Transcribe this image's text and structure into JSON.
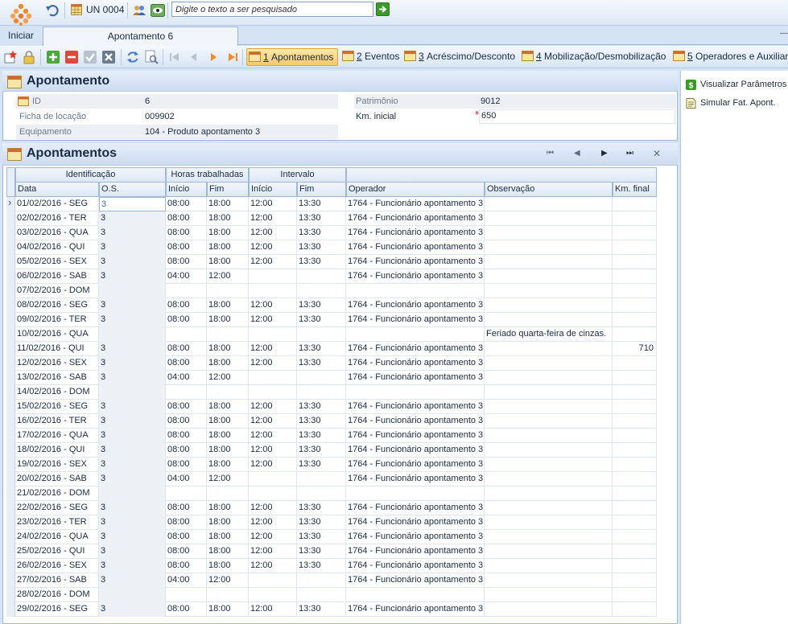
{
  "topbar": {
    "start_label": "Iniciar",
    "un_label": "UN 0004",
    "search_placeholder": "Digite o texto a ser pesquisado"
  },
  "tab": {
    "label": "Apontamento 6"
  },
  "toolbar": {
    "nav_tabs": [
      {
        "key": "1",
        "label": "Apontamentos"
      },
      {
        "key": "2",
        "label": "Eventos"
      },
      {
        "key": "3",
        "label": "Acréscimo/Desconto"
      },
      {
        "key": "4",
        "label": "Mobilização/Desmobilização"
      },
      {
        "key": "5",
        "label": "Operadores e Auxiliares"
      }
    ]
  },
  "side": {
    "links": [
      "Visualizar Parâmetros",
      "Simular Fat. Apont."
    ]
  },
  "apontamento": {
    "title": "Apontamento",
    "id_label": "ID",
    "id_value": "6",
    "ficha_label": "Ficha de locação",
    "ficha_value": "009902",
    "equip_label": "Equipamento",
    "equip_value": "104 - Produto apontamento 3",
    "patrimonio_label": "Patrimônio",
    "patrimonio_value": "9012",
    "km_label": "Km. inicial",
    "km_required": "*",
    "km_value": "650"
  },
  "grid": {
    "title": "Apontamentos",
    "bands": [
      "Identificação",
      "Horas trabalhadas",
      "Intervalo",
      ""
    ],
    "columns": [
      "Data",
      "O.S.",
      "Início",
      "Fim",
      "Início",
      "Fim",
      "Operador",
      "Observação",
      "Km. final"
    ],
    "rows": [
      [
        "01/02/2016 - SEG",
        "3",
        "08:00",
        "18:00",
        "12:00",
        "13:30",
        "1764 - Funcionário apontamento 3",
        "",
        ""
      ],
      [
        "02/02/2016 - TER",
        "3",
        "08:00",
        "18:00",
        "12:00",
        "13:30",
        "1764 - Funcionário apontamento 3",
        "",
        ""
      ],
      [
        "03/02/2016 - QUA",
        "3",
        "08:00",
        "18:00",
        "12:00",
        "13:30",
        "1764 - Funcionário apontamento 3",
        "",
        ""
      ],
      [
        "04/02/2016 - QUI",
        "3",
        "08:00",
        "18:00",
        "12:00",
        "13:30",
        "1764 - Funcionário apontamento 3",
        "",
        ""
      ],
      [
        "05/02/2016 - SEX",
        "3",
        "08:00",
        "18:00",
        "12:00",
        "13:30",
        "1764 - Funcionário apontamento 3",
        "",
        ""
      ],
      [
        "06/02/2016 - SAB",
        "3",
        "04:00",
        "12:00",
        "",
        "",
        "1764 - Funcionário apontamento 3",
        "",
        ""
      ],
      [
        "07/02/2016 - DOM",
        "",
        "",
        "",
        "",
        "",
        "",
        "",
        ""
      ],
      [
        "08/02/2016 - SEG",
        "3",
        "08:00",
        "18:00",
        "12:00",
        "13:30",
        "1764 - Funcionário apontamento 3",
        "",
        ""
      ],
      [
        "09/02/2016 - TER",
        "3",
        "08:00",
        "18:00",
        "12:00",
        "13:30",
        "1764 - Funcionário apontamento 3",
        "",
        ""
      ],
      [
        "10/02/2016 - QUA",
        "",
        "",
        "",
        "",
        "",
        "",
        "Feriado quarta-feira de cinzas.",
        ""
      ],
      [
        "11/02/2016 - QUI",
        "3",
        "08:00",
        "18:00",
        "12:00",
        "13:30",
        "1764 - Funcionário apontamento 3",
        "",
        "710"
      ],
      [
        "12/02/2016 - SEX",
        "3",
        "08:00",
        "18:00",
        "12:00",
        "13:30",
        "1764 - Funcionário apontamento 3",
        "",
        ""
      ],
      [
        "13/02/2016 - SAB",
        "3",
        "04:00",
        "12:00",
        "",
        "",
        "1764 - Funcionário apontamento 3",
        "",
        ""
      ],
      [
        "14/02/2016 - DOM",
        "",
        "",
        "",
        "",
        "",
        "",
        "",
        ""
      ],
      [
        "15/02/2016 - SEG",
        "3",
        "08:00",
        "18:00",
        "12:00",
        "13:30",
        "1764 - Funcionário apontamento 3",
        "",
        ""
      ],
      [
        "16/02/2016 - TER",
        "3",
        "08:00",
        "18:00",
        "12:00",
        "13:30",
        "1764 - Funcionário apontamento 3",
        "",
        ""
      ],
      [
        "17/02/2016 - QUA",
        "3",
        "08:00",
        "18:00",
        "12:00",
        "13:30",
        "1764 - Funcionário apontamento 3",
        "",
        ""
      ],
      [
        "18/02/2016 - QUI",
        "3",
        "08:00",
        "18:00",
        "12:00",
        "13:30",
        "1764 - Funcionário apontamento 3",
        "",
        ""
      ],
      [
        "19/02/2016 - SEX",
        "3",
        "08:00",
        "18:00",
        "12:00",
        "13:30",
        "1764 - Funcionário apontamento 3",
        "",
        ""
      ],
      [
        "20/02/2016 - SAB",
        "3",
        "04:00",
        "12:00",
        "",
        "",
        "1764 - Funcionário apontamento 3",
        "",
        ""
      ],
      [
        "21/02/2016 - DOM",
        "",
        "",
        "",
        "",
        "",
        "",
        "",
        ""
      ],
      [
        "22/02/2016 - SEG",
        "3",
        "08:00",
        "18:00",
        "12:00",
        "13:30",
        "1764 - Funcionário apontamento 3",
        "",
        ""
      ],
      [
        "23/02/2016 - TER",
        "3",
        "08:00",
        "18:00",
        "12:00",
        "13:30",
        "1764 - Funcionário apontamento 3",
        "",
        ""
      ],
      [
        "24/02/2016 - QUA",
        "3",
        "08:00",
        "18:00",
        "12:00",
        "13:30",
        "1764 - Funcionário apontamento 3",
        "",
        ""
      ],
      [
        "25/02/2016 - QUI",
        "3",
        "08:00",
        "18:00",
        "12:00",
        "13:30",
        "1764 - Funcionário apontamento 3",
        "",
        ""
      ],
      [
        "26/02/2016 - SEX",
        "3",
        "08:00",
        "18:00",
        "12:00",
        "13:30",
        "1764 - Funcionário apontamento 3",
        "",
        ""
      ],
      [
        "27/02/2016 - SAB",
        "3",
        "04:00",
        "12:00",
        "",
        "",
        "1764 - Funcionário apontamento 3",
        "",
        ""
      ],
      [
        "28/02/2016 - DOM",
        "",
        "",
        "",
        "",
        "",
        "",
        "",
        ""
      ],
      [
        "29/02/2016 - SEG",
        "3",
        "08:00",
        "18:00",
        "12:00",
        "13:30",
        "1764 - Funcionário apontamento 3",
        "",
        ""
      ]
    ]
  }
}
